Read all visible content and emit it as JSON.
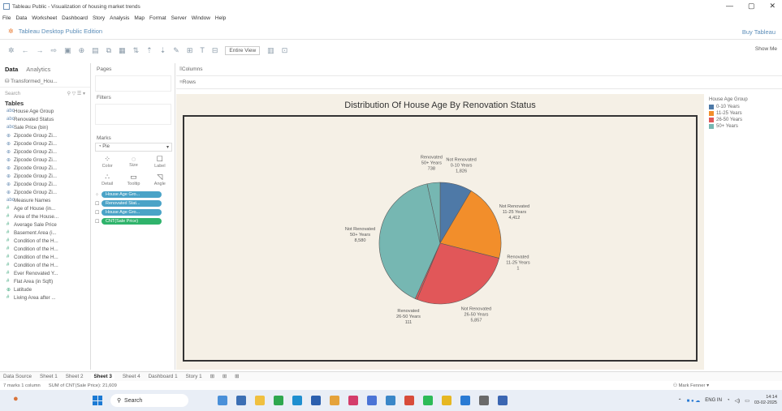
{
  "window": {
    "title": "Tableau Public - Visualization of housing market trends",
    "controls": [
      "—",
      "▢",
      "✕"
    ]
  },
  "menu": [
    "File",
    "Data",
    "Worksheet",
    "Dashboard",
    "Story",
    "Analysis",
    "Map",
    "Format",
    "Server",
    "Window",
    "Help"
  ],
  "publicbar": {
    "name": "Tableau Desktop Public Edition",
    "buy": "Buy Tableau"
  },
  "toolbar": {
    "view": "Entire View",
    "show_me": "Show Me"
  },
  "left": {
    "tabs": [
      "Data",
      "Analytics"
    ],
    "datasource": "Transformed_Hou...",
    "search_placeholder": "Search",
    "tables_header": "Tables",
    "fields": [
      {
        "icon": "abc",
        "label": "House Age Group",
        "type": "dim"
      },
      {
        "icon": "abc",
        "label": "Renovated Status",
        "type": "dim"
      },
      {
        "icon": "abc",
        "label": "Sale Price (bin)",
        "type": "dim"
      },
      {
        "icon": "⊕",
        "label": "Zipcode Group Zi...",
        "type": "dim"
      },
      {
        "icon": "⊕",
        "label": "Zipcode Group Zi...",
        "type": "dim"
      },
      {
        "icon": "⊕",
        "label": "Zipcode Group Zi...",
        "type": "dim"
      },
      {
        "icon": "⊕",
        "label": "Zipcode Group Zi...",
        "type": "dim"
      },
      {
        "icon": "⊕",
        "label": "Zipcode Group Zi...",
        "type": "dim"
      },
      {
        "icon": "⊕",
        "label": "Zipcode Group Zi...",
        "type": "dim"
      },
      {
        "icon": "⊕",
        "label": "Zipcode Group Zi...",
        "type": "dim"
      },
      {
        "icon": "⊕",
        "label": "Zipcode Group Zi...",
        "type": "dim"
      },
      {
        "icon": "abc",
        "label": "Measure Names",
        "type": "dim"
      },
      {
        "icon": "#",
        "label": "Age of House (in...",
        "type": "measure"
      },
      {
        "icon": "#",
        "label": "Area of the House...",
        "type": "measure"
      },
      {
        "icon": "#",
        "label": "Average Sale Price",
        "type": "measure"
      },
      {
        "icon": "#",
        "label": "Basement Area (i...",
        "type": "measure"
      },
      {
        "icon": "#",
        "label": "Condition of the H...",
        "type": "measure"
      },
      {
        "icon": "#",
        "label": "Condition of the H...",
        "type": "measure"
      },
      {
        "icon": "#",
        "label": "Condition of the H...",
        "type": "measure"
      },
      {
        "icon": "#",
        "label": "Condition of the H...",
        "type": "measure"
      },
      {
        "icon": "#",
        "label": "Ever Renovated Y...",
        "type": "measure"
      },
      {
        "icon": "#",
        "label": "Flat Area (in Sqft)",
        "type": "measure"
      },
      {
        "icon": "⊕",
        "label": "Latitude",
        "type": "measure"
      },
      {
        "icon": "#",
        "label": "Living Area after ...",
        "type": "measure"
      }
    ]
  },
  "mid": {
    "pages": "Pages",
    "filters": "Filters",
    "marks": "Marks",
    "mark_type": "Pie",
    "buttons": [
      {
        "glyph": "⁘",
        "label": "Color"
      },
      {
        "glyph": "◌",
        "label": "Size"
      },
      {
        "glyph": "☐",
        "label": "Label"
      },
      {
        "glyph": "∴",
        "label": "Detail"
      },
      {
        "glyph": "▭",
        "label": "Tooltip"
      },
      {
        "glyph": "◹",
        "label": "Angle"
      }
    ],
    "pills": [
      {
        "icon": "⁘",
        "label": "House Age Gro...",
        "color": "blue"
      },
      {
        "icon": "☐",
        "label": "Renovated Stat...",
        "color": "blue"
      },
      {
        "icon": "☐",
        "label": "House Age Gro...",
        "color": "blue"
      },
      {
        "icon": "☐",
        "label": "CNT(Sale Price)",
        "color": "green"
      }
    ]
  },
  "shelves": {
    "columns": "Columns",
    "rows": "Rows"
  },
  "legend": {
    "title": "House Age Group",
    "items": [
      {
        "label": "0-10 Years",
        "color": "#4e79a7"
      },
      {
        "label": "11-25 Years",
        "color": "#f28e2b"
      },
      {
        "label": "26-50 Years",
        "color": "#e15759"
      },
      {
        "label": "50+ Years",
        "color": "#76b7b2"
      }
    ]
  },
  "chart_data": {
    "type": "pie",
    "title": "Distribution Of House Age By Renovation Status",
    "slices": [
      {
        "status": "Not Renovated",
        "age_group": "0-10 Years",
        "value": "1,826",
        "color": "#4e79a7"
      },
      {
        "status": "Not Renovated",
        "age_group": "11-25 Years",
        "value": "4,412",
        "color": "#f28e2b"
      },
      {
        "status": "Renovated",
        "age_group": "11-25 Years",
        "value": "1",
        "color": "#f28e2b"
      },
      {
        "status": "Not Renovated",
        "age_group": "26-50 Years",
        "value": "5,857",
        "color": "#e15759"
      },
      {
        "status": "Renovated",
        "age_group": "26-50 Years",
        "value": "111",
        "color": "#e15759"
      },
      {
        "status": "Not Renovated",
        "age_group": "50+ Years",
        "value": "8,580",
        "color": "#76b7b2"
      },
      {
        "status": "Renovated",
        "age_group": "50+ Years",
        "value": "738",
        "color": "#76b7b2"
      }
    ]
  },
  "sheets": [
    "Data Source",
    "Sheet 1",
    "Sheet 2",
    "Sheet 3",
    "Sheet 4",
    "Dashboard 1",
    "Story 1"
  ],
  "active_sheet": "Sheet 3",
  "status": {
    "marks": "7 marks 1 column",
    "sum": "SUM of CNT(Sale Price): 21,609",
    "user": "Mark Fenner"
  },
  "taskbar": {
    "search": "Search",
    "lang": "ENG IN",
    "time": "14:14",
    "date": "03-02-2025"
  }
}
